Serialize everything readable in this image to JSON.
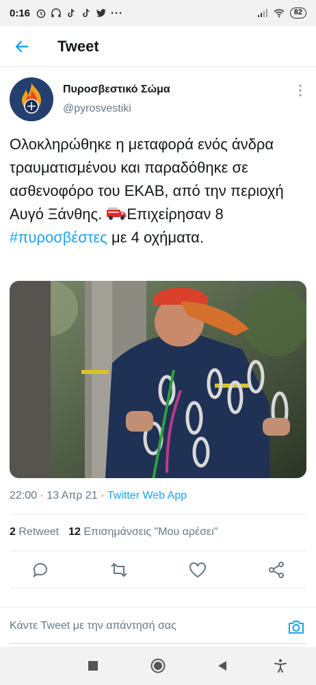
{
  "status_bar": {
    "time": "0:16",
    "battery": "82"
  },
  "header": {
    "title": "Tweet"
  },
  "tweet": {
    "author_name": "Πυροσβεστικό Σώμα",
    "author_handle": "@pyrosvestiki",
    "text_part1": "Ολοκληρώθηκε η μεταφορά ενός άνδρα τραυματισμένου και παραδόθηκε σε ασθενοφόρο του ΕΚΑΒ, από την περιοχή Αυγό Ξάνθης. ",
    "text_part2": "Επιχείρησαν 8 ",
    "hashtag": "#πυροσβέστες",
    "text_part3": " με 4 οχήματα.",
    "time": "22:00",
    "date": "13 Απρ 21",
    "source": "Twitter Web App",
    "retweet_count": "2",
    "retweet_label": "Retweet",
    "like_count": "12",
    "like_label": "Επισημάνσεις \"Μου αρέσει\""
  },
  "reply": {
    "placeholder": "Κάντε Tweet με την απάντησή σας"
  },
  "colors": {
    "accent": "#1da1f2",
    "muted": "#657786"
  }
}
